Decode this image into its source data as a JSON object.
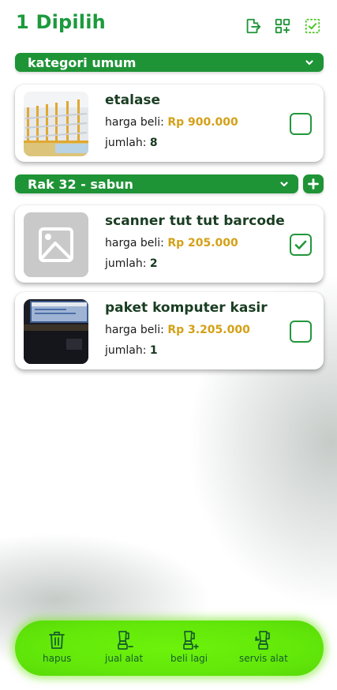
{
  "header": {
    "title": "1 Dipilih",
    "icons": [
      "export-icon",
      "add-grid-icon",
      "select-all-icon"
    ]
  },
  "groups": [
    {
      "label": "kategori umum",
      "items": [
        {
          "name": "etalase",
          "price_label": "harga beli:",
          "price": "Rp 900.000",
          "qty_label": "jumlah:",
          "qty": "8",
          "checked": false
        }
      ]
    },
    {
      "label": "Rak 32 - sabun",
      "items": [
        {
          "name": "scanner tut tut barcode",
          "price_label": "harga beli:",
          "price": "Rp 205.000",
          "qty_label": "jumlah:",
          "qty": "2",
          "checked": true
        },
        {
          "name": "paket komputer kasir",
          "price_label": "harga beli:",
          "price": "Rp 3.205.000",
          "qty_label": "jumlah:",
          "qty": "1",
          "checked": false
        }
      ]
    }
  ],
  "bottom_bar": {
    "items": [
      {
        "label": "hapus",
        "icon": "trash-icon"
      },
      {
        "label": "jual alat",
        "icon": "blender-minus-icon"
      },
      {
        "label": "beli lagi",
        "icon": "blender-plus-icon"
      },
      {
        "label": "servis alat",
        "icon": "blender-wrench-icon"
      }
    ]
  },
  "colors": {
    "primary": "#1e9436",
    "title": "#1c9a3c",
    "price": "#d4a017",
    "bottom_bar": "#63e80a"
  }
}
